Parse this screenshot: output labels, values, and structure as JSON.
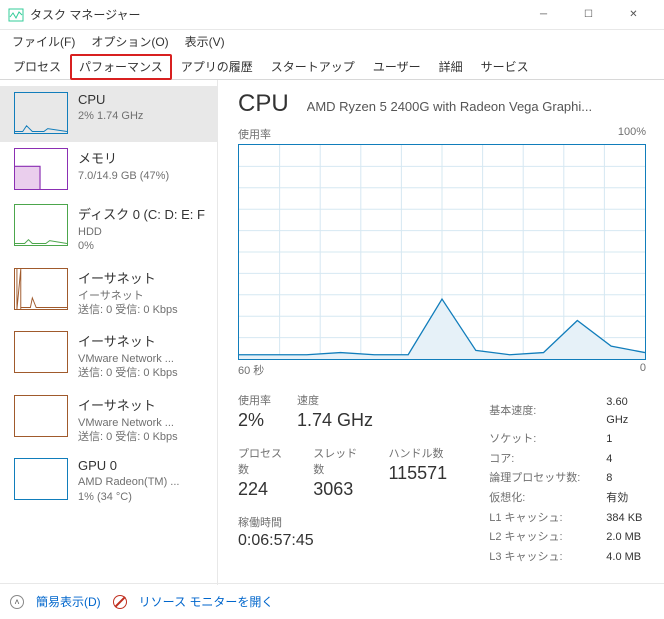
{
  "window": {
    "title": "タスク マネージャー"
  },
  "menu": {
    "file": "ファイル(F)",
    "options": "オプション(O)",
    "view": "表示(V)"
  },
  "tabs": [
    "プロセス",
    "パフォーマンス",
    "アプリの履歴",
    "スタートアップ",
    "ユーザー",
    "詳細",
    "サービス"
  ],
  "sidebar": [
    {
      "title": "CPU",
      "sub": "2%  1.74 GHz",
      "color": "#117dbb"
    },
    {
      "title": "メモリ",
      "sub": "7.0/14.9 GB (47%)",
      "color": "#8b2fb3"
    },
    {
      "title": "ディスク 0 (C: D: E: F",
      "sub": "HDD",
      "sub2": "0%",
      "color": "#4ca64c"
    },
    {
      "title": "イーサネット",
      "sub": "イーサネット",
      "sub2": "送信: 0 受信: 0 Kbps",
      "color": "#a05a2c"
    },
    {
      "title": "イーサネット",
      "sub": "VMware Network ...",
      "sub2": "送信: 0 受信: 0 Kbps",
      "color": "#a05a2c"
    },
    {
      "title": "イーサネット",
      "sub": "VMware Network ...",
      "sub2": "送信: 0 受信: 0 Kbps",
      "color": "#a05a2c"
    },
    {
      "title": "GPU 0",
      "sub": "AMD Radeon(TM) ...",
      "sub2": "1%  (34 °C)",
      "color": "#117dbb"
    }
  ],
  "main": {
    "title": "CPU",
    "subtitle": "AMD Ryzen 5 2400G with Radeon Vega Graphi...",
    "chart_top_left": "使用率",
    "chart_top_right": "100%",
    "chart_bottom_left": "60 秒",
    "chart_bottom_right": "0"
  },
  "stats": {
    "usage_label": "使用率",
    "usage": "2%",
    "speed_label": "速度",
    "speed": "1.74 GHz",
    "processes_label": "プロセス数",
    "processes": "224",
    "threads_label": "スレッド数",
    "threads": "3063",
    "handles_label": "ハンドル数",
    "handles": "115571",
    "uptime_label": "稼働時間",
    "uptime": "0:06:57:45"
  },
  "details": [
    [
      "基本速度:",
      "3.60 GHz"
    ],
    [
      "ソケット:",
      "1"
    ],
    [
      "コア:",
      "4"
    ],
    [
      "論理プロセッサ数:",
      "8"
    ],
    [
      "仮想化:",
      "有効"
    ],
    [
      "L1 キャッシュ:",
      "384 KB"
    ],
    [
      "L2 キャッシュ:",
      "2.0 MB"
    ],
    [
      "L3 キャッシュ:",
      "4.0 MB"
    ]
  ],
  "footer": {
    "less": "簡易表示(D)",
    "resmon": "リソース モニターを開く"
  },
  "chart_data": {
    "type": "line",
    "title": "使用率",
    "xlabel": "60 秒 → 0",
    "ylabel": "%",
    "ylim": [
      0,
      100
    ],
    "x_seconds": [
      60,
      55,
      50,
      45,
      40,
      35,
      30,
      25,
      20,
      15,
      10,
      5,
      0
    ],
    "values_pct": [
      2,
      2,
      2,
      3,
      2,
      2,
      28,
      4,
      2,
      3,
      18,
      6,
      3
    ]
  }
}
